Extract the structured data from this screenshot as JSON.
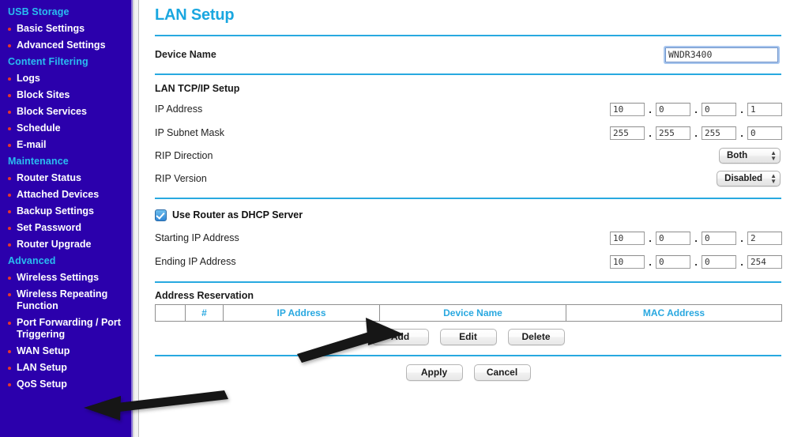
{
  "sidebar": {
    "items": [
      {
        "label": "USB Storage",
        "type": "section"
      },
      {
        "label": "Basic Settings",
        "type": "item"
      },
      {
        "label": "Advanced Settings",
        "type": "item"
      },
      {
        "label": "Content Filtering",
        "type": "section"
      },
      {
        "label": "Logs",
        "type": "item"
      },
      {
        "label": "Block Sites",
        "type": "item"
      },
      {
        "label": "Block Services",
        "type": "item"
      },
      {
        "label": "Schedule",
        "type": "item"
      },
      {
        "label": "E-mail",
        "type": "item"
      },
      {
        "label": "Maintenance",
        "type": "section"
      },
      {
        "label": "Router Status",
        "type": "item"
      },
      {
        "label": "Attached Devices",
        "type": "item"
      },
      {
        "label": "Backup Settings",
        "type": "item"
      },
      {
        "label": "Set Password",
        "type": "item"
      },
      {
        "label": "Router Upgrade",
        "type": "item"
      },
      {
        "label": "Advanced",
        "type": "section"
      },
      {
        "label": "Wireless Settings",
        "type": "item"
      },
      {
        "label": "Wireless Repeating Function",
        "type": "item"
      },
      {
        "label": "Port Forwarding / Port Triggering",
        "type": "item"
      },
      {
        "label": "WAN Setup",
        "type": "item"
      },
      {
        "label": "LAN Setup",
        "type": "item"
      },
      {
        "label": "QoS Setup",
        "type": "item"
      }
    ]
  },
  "page": {
    "title": "LAN Setup",
    "device_name_label": "Device Name",
    "device_name_value": "WNDR3400",
    "tcpip_heading": "LAN TCP/IP Setup",
    "ip_address_label": "IP Address",
    "ip_address": [
      "10",
      "0",
      "0",
      "1"
    ],
    "subnet_mask_label": "IP Subnet Mask",
    "subnet_mask": [
      "255",
      "255",
      "255",
      "0"
    ],
    "rip_direction_label": "RIP Direction",
    "rip_direction_value": "Both",
    "rip_version_label": "RIP Version",
    "rip_version_value": "Disabled",
    "dhcp_checkbox_label": "Use Router as DHCP Server",
    "starting_ip_label": "Starting IP Address",
    "starting_ip": [
      "10",
      "0",
      "0",
      "2"
    ],
    "ending_ip_label": "Ending IP Address",
    "ending_ip": [
      "10",
      "0",
      "0",
      "254"
    ],
    "address_reservation_heading": "Address Reservation",
    "table_headers": [
      "",
      "#",
      "IP Address",
      "Device Name",
      "MAC Address"
    ],
    "table_rows": [],
    "add_label": "Add",
    "edit_label": "Edit",
    "delete_label": "Delete",
    "apply_label": "Apply",
    "cancel_label": "Cancel"
  },
  "colors": {
    "sidebar_bg": "#2b00ac",
    "section_text": "#29bdf0",
    "item_text": "#ffffff",
    "bullet": "#e8362a",
    "accent_blue": "#28a9e0",
    "annotation": "#111111"
  }
}
